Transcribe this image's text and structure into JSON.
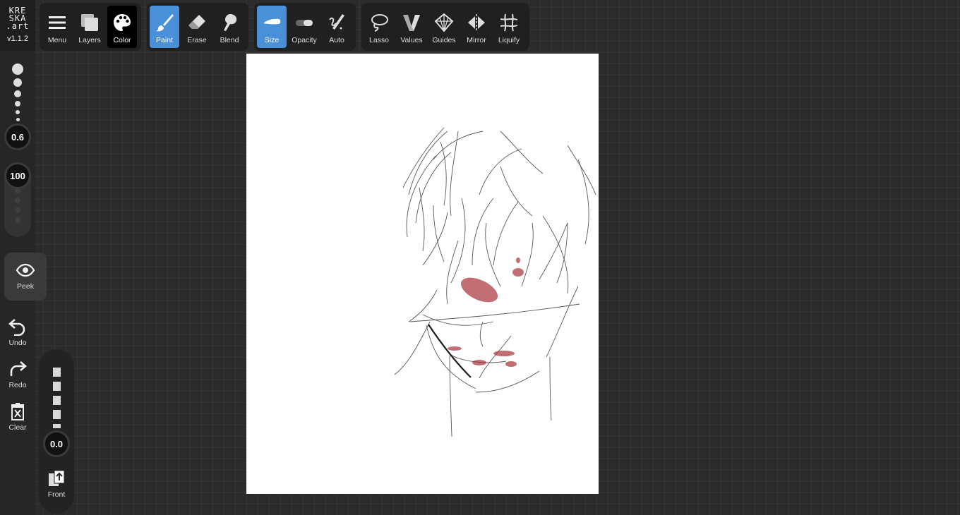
{
  "app": {
    "logo_lines": [
      "KRE",
      "SKA",
      ".art"
    ],
    "version": "v1.1.2"
  },
  "toolbar": {
    "group1": [
      {
        "label": "Menu",
        "icon": "menu-icon"
      },
      {
        "label": "Layers",
        "icon": "layers-icon"
      },
      {
        "label": "Color",
        "icon": "palette-icon",
        "state": "active"
      }
    ],
    "group2": [
      {
        "label": "Paint",
        "icon": "brush-icon",
        "state": "active"
      },
      {
        "label": "Erase",
        "icon": "eraser-icon"
      },
      {
        "label": "Blend",
        "icon": "blend-icon"
      }
    ],
    "group3": [
      {
        "label": "Size",
        "icon": "size-icon",
        "state": "active"
      },
      {
        "label": "Opacity",
        "icon": "opacity-icon"
      },
      {
        "label": "Auto",
        "icon": "auto-icon"
      }
    ],
    "group4": [
      {
        "label": "Lasso",
        "icon": "lasso-icon"
      },
      {
        "label": "Values",
        "icon": "values-icon"
      },
      {
        "label": "Guides",
        "icon": "guides-icon"
      },
      {
        "label": "Mirror",
        "icon": "mirror-icon"
      },
      {
        "label": "Liquify",
        "icon": "liquify-icon"
      }
    ]
  },
  "sidebar": {
    "brush_size": "0.6",
    "brush_opacity": "100",
    "peek_label": "Peek",
    "undo_label": "Undo",
    "redo_label": "Redo",
    "clear_label": "Clear"
  },
  "layer_panel": {
    "value": "0.0",
    "front_label": "Front"
  },
  "colors": {
    "accent": "#4a90d9",
    "background": "#2b2b2b",
    "canvas": "#ffffff",
    "paint": "#a8323c"
  }
}
